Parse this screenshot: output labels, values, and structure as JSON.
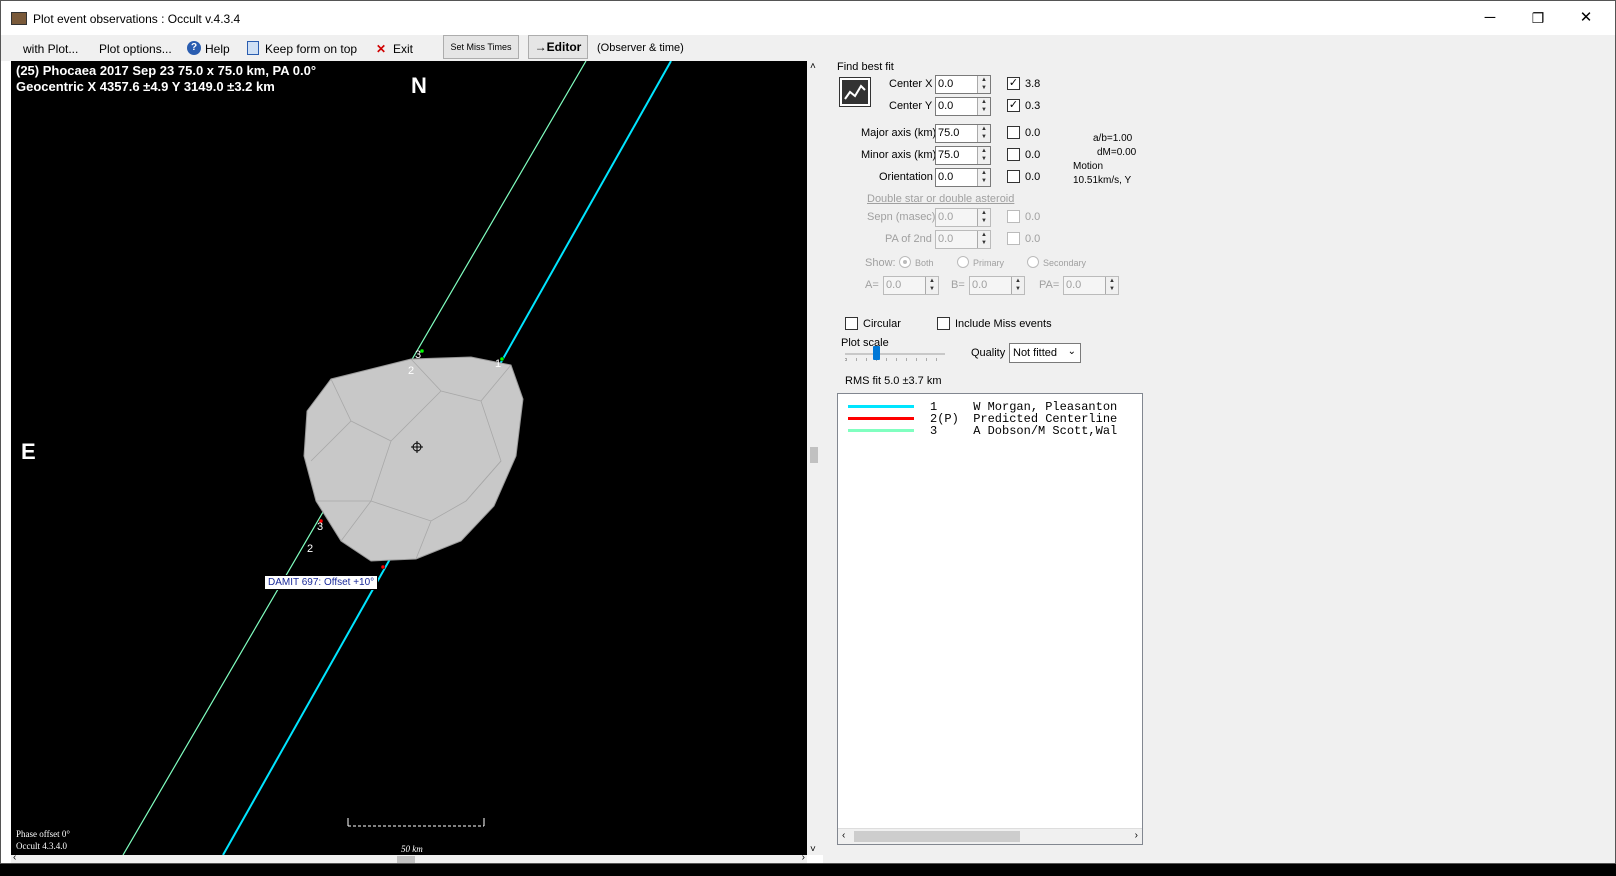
{
  "window": {
    "title": "Plot event observations : Occult v.4.3.4",
    "minimize": "─",
    "restore": "❐",
    "close": "✕"
  },
  "menu": {
    "with_plot": "with Plot...",
    "plot_options": "Plot options...",
    "help": "Help",
    "keep_on_top": "Keep form on top",
    "exit": "Exit",
    "set_miss_times": "Set Miss Times",
    "editor": "→Editor",
    "observer_time": "(Observer & time)"
  },
  "plot": {
    "header1": "(25) Phocaea  2017 Sep 23   75.0 x 75.0 km, PA 0.0°",
    "header2": "Geocentric  X  4357.6 ±4.9  Y 3149.0 ±3.2 km",
    "north": "N",
    "east": "E",
    "labels": [
      "3",
      "2",
      "1",
      "3",
      "2",
      "1"
    ],
    "damit": "DAMIT 697: Offset +10°",
    "footer1": "Phase offset 0°",
    "footer2": "Occult 4.3.4.0",
    "scale_label": "50 km",
    "colors": {
      "chord1": "#00e5ff",
      "chord3": "#80ffc0",
      "body": "#c8c8c8"
    }
  },
  "panel": {
    "find_best_fit": "Find best fit",
    "center_x": {
      "label": "Center X",
      "value": "0.0",
      "checked": true,
      "result": "3.8"
    },
    "center_y": {
      "label": "Center Y",
      "value": "0.0",
      "checked": true,
      "result": "0.3"
    },
    "major": {
      "label": "Major axis (km)",
      "value": "75.0",
      "result": "0.0"
    },
    "minor": {
      "label": "Minor axis (km)",
      "value": "75.0",
      "result": "0.0"
    },
    "orientation": {
      "label": "Orientation",
      "value": "0.0",
      "result": "0.0"
    },
    "ab": "a/b=1.00",
    "dm": "dM=0.00",
    "motion": "Motion",
    "motion_val": "10.51km/s, Y",
    "double_star": "Double star  or  double asteroid",
    "sepn": {
      "label": "Sepn (masec)",
      "value": "0.0",
      "result": "0.0"
    },
    "pa2nd": {
      "label": "PA of 2nd",
      "value": "0.0",
      "result": "0.0"
    },
    "show": "Show:",
    "both": "Both",
    "primary": "Primary",
    "secondary": "Secondary",
    "a_label": "A=",
    "a_val": "0.0",
    "b_label": "B=",
    "b_val": "0.0",
    "pa_label": "PA=",
    "pa_val": "0.0",
    "circular": "Circular",
    "include_miss": "Include Miss events",
    "plot_scale": "Plot scale",
    "quality_label": "Quality",
    "quality_value": "Not fitted",
    "rms": "RMS fit 5.0 ±3.7 km",
    "list": [
      {
        "text": "1     W Morgan, Pleasanton",
        "color": "#00e5ff"
      },
      {
        "text": "2(P)  Predicted Centerline",
        "color": "#ff0000"
      },
      {
        "text": "3     A Dobson/M Scott,Wal",
        "color": "#80ffc0"
      }
    ]
  }
}
